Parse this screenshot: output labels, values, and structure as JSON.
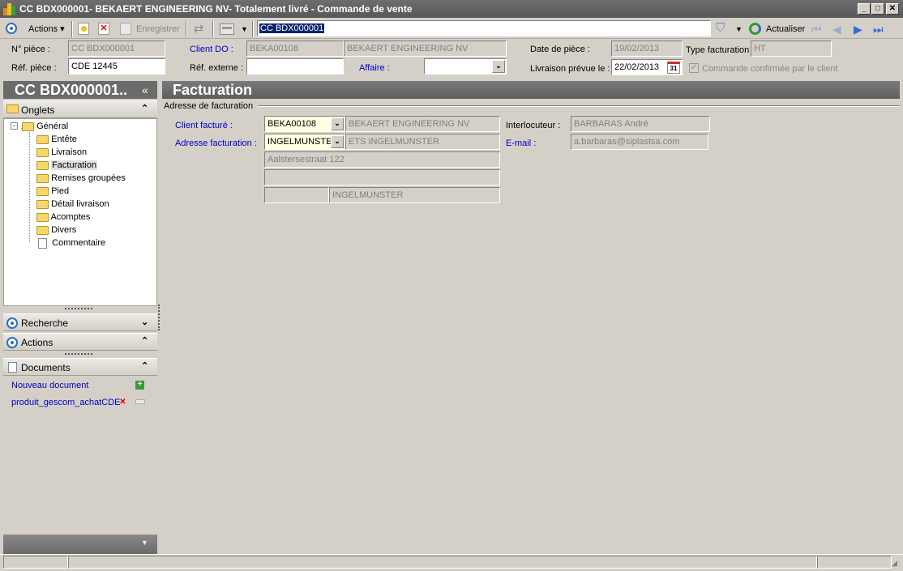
{
  "window": {
    "title": "CC BDX000001- BEKAERT ENGINEERING NV- Totalement livré -  Commande de vente"
  },
  "toolbar": {
    "actions_label": "Actions",
    "save_label": "Enregistrer",
    "search_value": "CC BDX000001",
    "refresh_label": "Actualiser"
  },
  "header": {
    "num_piece_label": "N° pièce :",
    "num_piece_value": "CC BDX000001",
    "ref_piece_label": "Réf. pièce :",
    "ref_piece_value": "CDE 12445",
    "client_do_label": "Client DO :",
    "client_do_code": "BEKA00108",
    "client_do_name": "BEKAERT ENGINEERING NV",
    "ref_externe_label": "Réf. externe :",
    "ref_externe_value": "",
    "affaire_label": "Affaire :",
    "affaire_value": "",
    "date_piece_label": "Date de pièce :",
    "date_piece_value": "19/02/2013",
    "livraison_label": "Livraison prévue le :",
    "livraison_value": "22/02/2013",
    "type_fact_label": "Type facturation",
    "type_fact_value": "HT",
    "confirmed_label": "Commande confirmée par le client"
  },
  "left": {
    "title": "CC BDX000001..",
    "onglets_label": "Onglets",
    "tree": {
      "root": "Général",
      "items": [
        "Entête",
        "Livraison",
        "Facturation",
        "Remises groupées",
        "Pied",
        "Détail livraison",
        "Acomptes",
        "Divers",
        "Commentaire"
      ]
    },
    "recherche_label": "Recherche",
    "actions_label": "Actions",
    "documents_label": "Documents",
    "new_doc_label": "Nouveau document",
    "doc_item_label": "produit_gescom_achatCDE"
  },
  "main": {
    "title": "Facturation",
    "group_label": "Adresse de facturation",
    "client_facture_label": "Client facturé :",
    "client_facture_code": "BEKA00108",
    "client_facture_name": "BEKAERT ENGINEERING NV",
    "adresse_label": "Adresse facturation :",
    "adresse_code": "INGELMUNSTER",
    "adresse_name": "ETS INGELMUNSTER",
    "street": "Aalstersestraat 122",
    "line2": "",
    "zip": "",
    "city": "INGELMUNSTER",
    "interlocuteur_label": "Interlocuteur :",
    "interlocuteur_value": "BARBARAS André",
    "email_label": "E-mail :",
    "email_value": "a.barbaras@siplastsa.com"
  }
}
